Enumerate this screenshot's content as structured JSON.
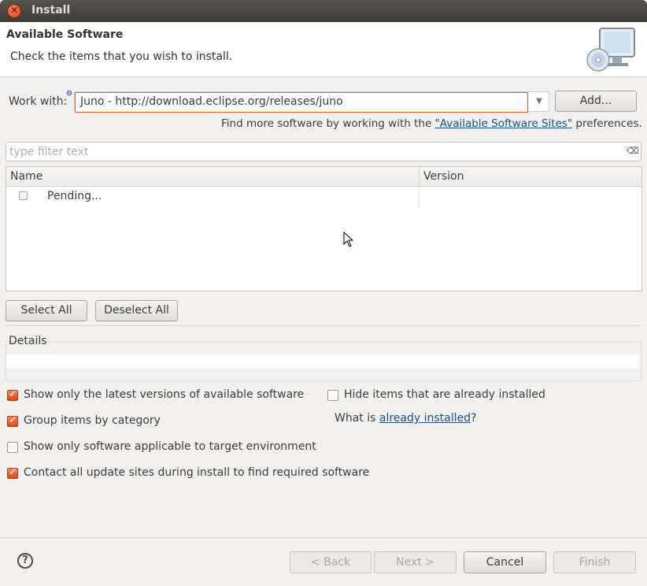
{
  "window": {
    "title": "Install"
  },
  "banner": {
    "heading": "Available Software",
    "subtitle": "Check the items that you wish to install."
  },
  "work_with": {
    "label": "Work with:",
    "value": "Juno - http://download.eclipse.org/releases/juno",
    "add_button": "Add..."
  },
  "find_more": {
    "prefix": "Find more software by working with the ",
    "link": "\"Available Software Sites\"",
    "suffix": " preferences."
  },
  "filter": {
    "placeholder": "type filter text"
  },
  "table": {
    "columns": [
      "Name",
      "Version"
    ],
    "rows": [
      {
        "name": "Pending...",
        "version": ""
      }
    ]
  },
  "selection_buttons": {
    "select_all": "Select All",
    "deselect_all": "Deselect All"
  },
  "details": {
    "label": "Details"
  },
  "options": {
    "latest_versions": {
      "label": "Show only the latest versions of available software",
      "checked": true
    },
    "hide_installed": {
      "label": "Hide items that are already installed",
      "checked": false
    },
    "group_by_category": {
      "label": "Group items by category",
      "checked": true
    },
    "what_is_prefix": "What is ",
    "already_installed_link": "already installed",
    "what_is_suffix": "?",
    "target_env": {
      "label": "Show only software applicable to target environment",
      "checked": false
    },
    "contact_sites": {
      "label": "Contact all update sites during install to find required software",
      "checked": true
    }
  },
  "footer": {
    "back": "< Back",
    "next": "Next >",
    "cancel": "Cancel",
    "finish": "Finish",
    "help": "?"
  },
  "colors": {
    "accent": "#dd4814",
    "link": "#1b4e8a",
    "titlebar": "#3d3c38"
  }
}
